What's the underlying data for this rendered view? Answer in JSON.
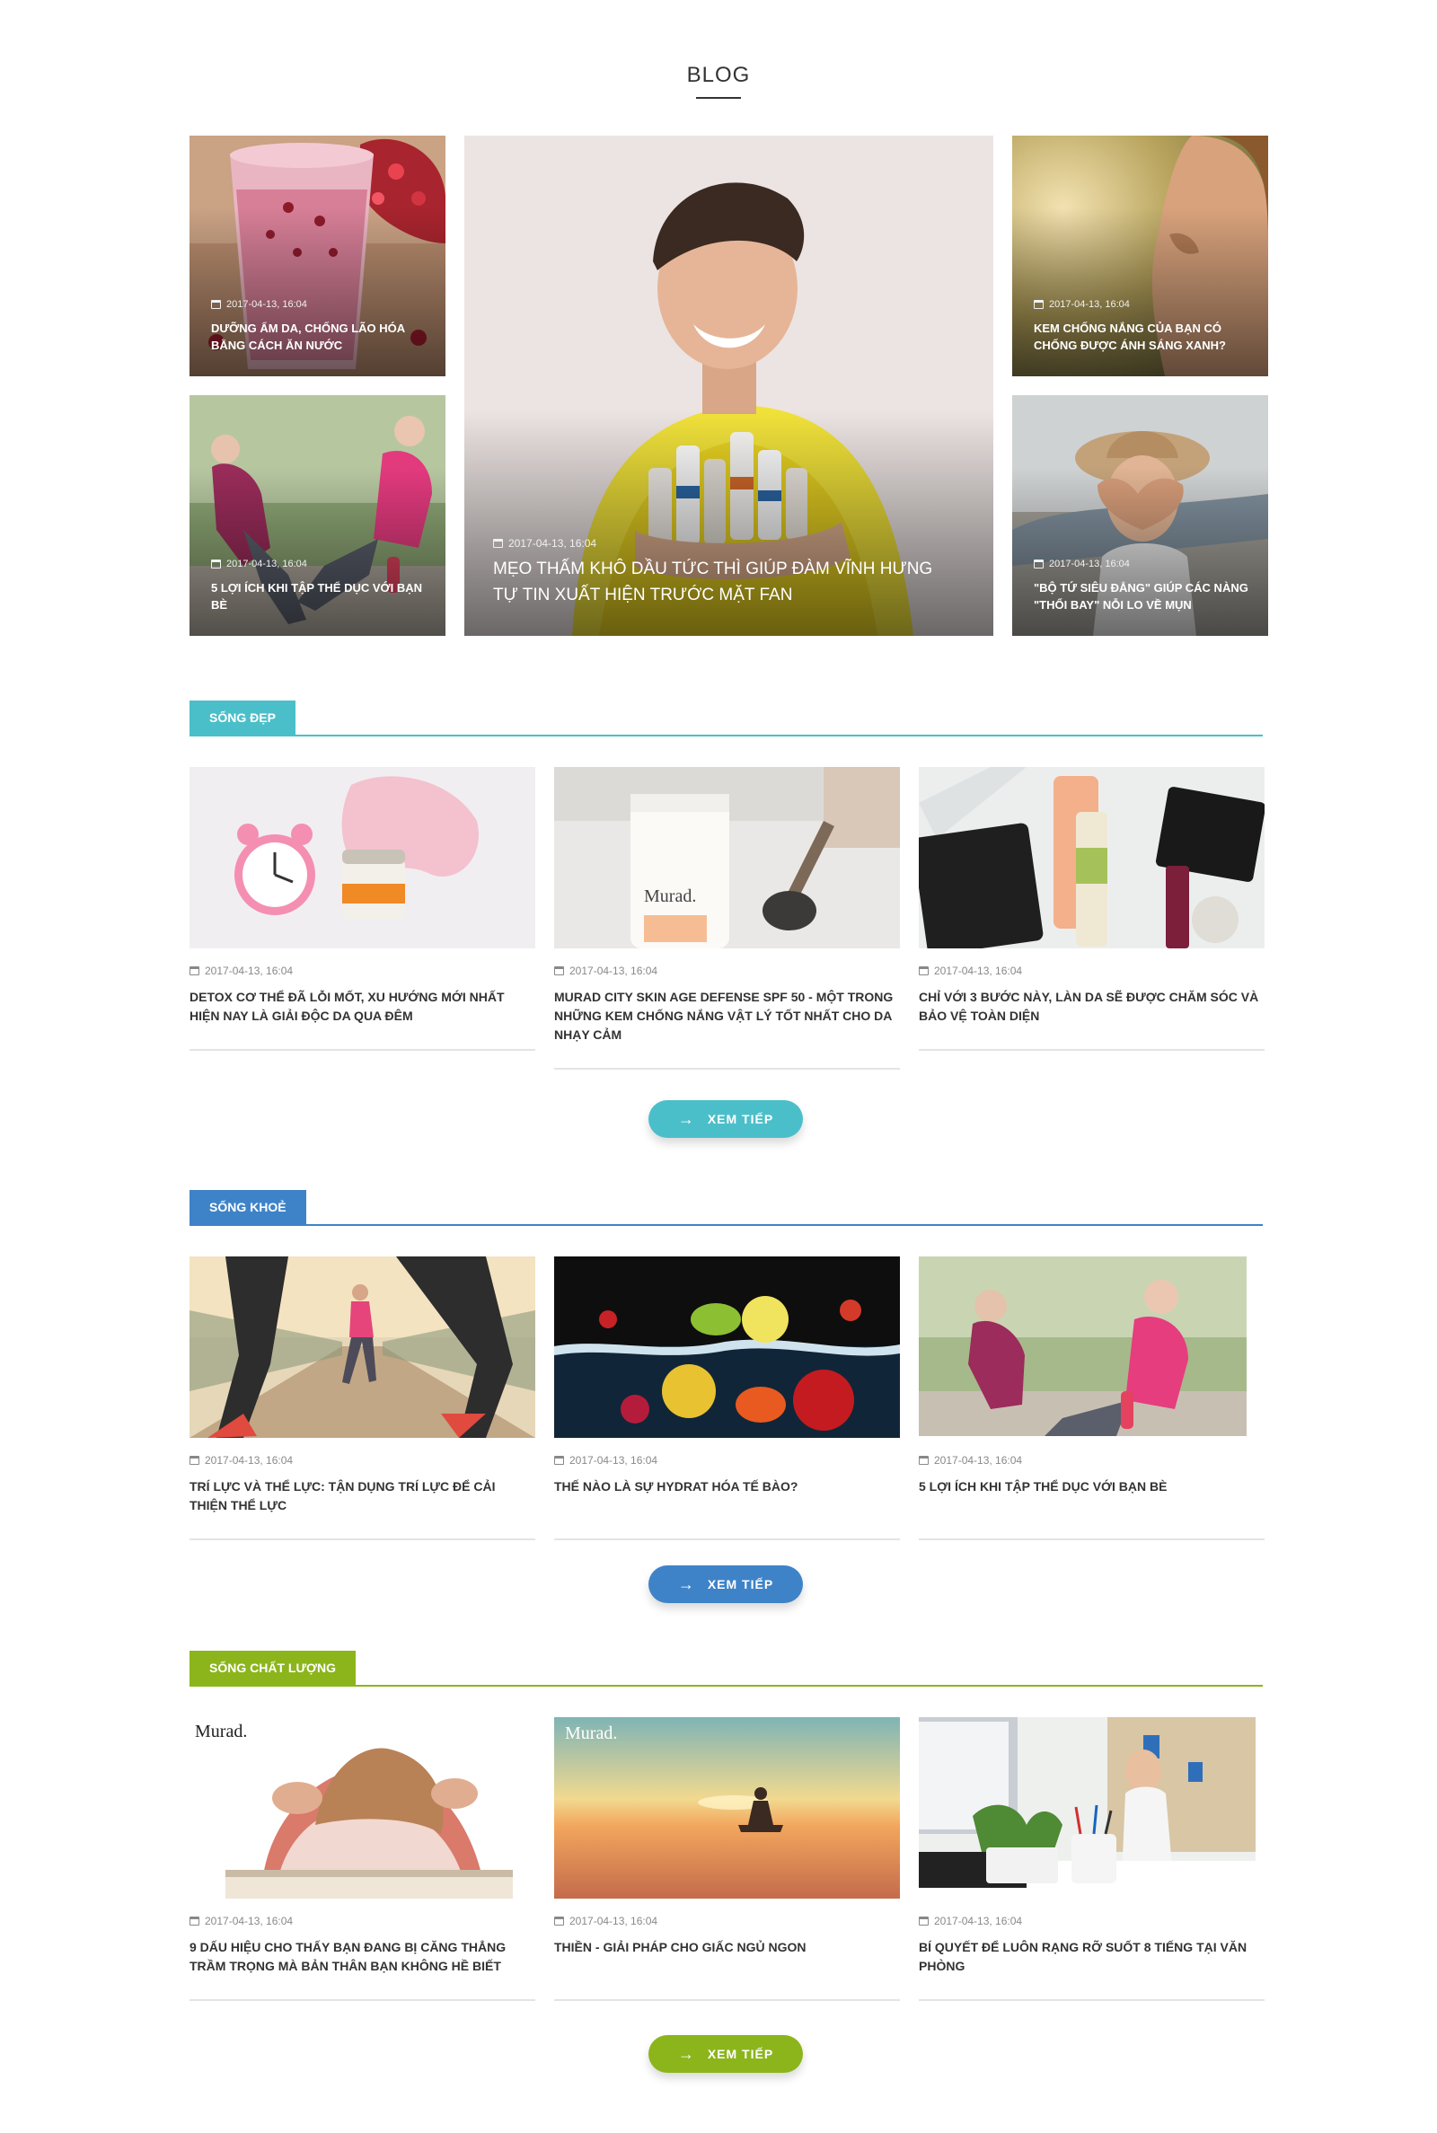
{
  "page": {
    "title": "BLOG"
  },
  "featured": {
    "top_left": {
      "date": "2017-04-13, 16:04",
      "title": "DƯỠNG ẨM DA, CHỐNG LÃO HÓA BẰNG CÁCH ĂN NƯỚC"
    },
    "bottom_left": {
      "date": "2017-04-13, 16:04",
      "title": "5 LỢI ÍCH KHI TẬP THỂ DỤC VỚI BẠN BÈ"
    },
    "center": {
      "date": "2017-04-13, 16:04",
      "title": "MẸO THẤM KHÔ DẦU TỨC THÌ GIÚP ĐÀM VĨNH HƯNG TỰ TIN XUẤT HIỆN TRƯỚC MẶT FAN"
    },
    "top_right": {
      "date": "2017-04-13, 16:04",
      "title": "KEM CHỐNG NẮNG CỦA BẠN CÓ CHỐNG ĐƯỢC ÁNH SÁNG XANH?"
    },
    "bottom_right": {
      "date": "2017-04-13, 16:04",
      "title": "\"BỘ TỨ SIÊU ĐẲNG\" GIÚP CÁC NÀNG \"THỔI BAY\" NỖI LO VỀ MỤN"
    }
  },
  "sections": [
    {
      "label": "SỐNG ĐẸP",
      "color": "#4bbfc9",
      "more_label": "XEM TIẾP",
      "posts": [
        {
          "date": "2017-04-13, 16:04",
          "title": "DETOX CƠ THỂ ĐÃ LỖI MỐT, XU HƯỚNG MỚI NHẤT HIỆN NAY LÀ GIẢI ĐỘC DA QUA ĐÊM"
        },
        {
          "date": "2017-04-13, 16:04",
          "title": "MURAD CITY SKIN AGE DEFENSE SPF 50 - MỘT TRONG NHỮNG KEM CHỐNG NẮNG VẬT LÝ TỐT NHẤT CHO DA NHẠY CẢM"
        },
        {
          "date": "2017-04-13, 16:04",
          "title": "CHỈ VỚI 3 BƯỚC NÀY, LÀN DA SẼ ĐƯỢC CHĂM SÓC VÀ BẢO VỆ TOÀN DIỆN"
        }
      ]
    },
    {
      "label": "SỐNG KHOẺ",
      "color": "#3e83c8",
      "more_label": "XEM TIẾP",
      "posts": [
        {
          "date": "2017-04-13, 16:04",
          "title": "TRÍ LỰC VÀ THỂ LỰC: TẬN DỤNG TRÍ LỰC ĐỂ CẢI THIỆN THỂ LỰC"
        },
        {
          "date": "2017-04-13, 16:04",
          "title": "THẾ NÀO LÀ SỰ HYDRAT HÓA TẾ BÀO?"
        },
        {
          "date": "2017-04-13, 16:04",
          "title": "5 LỢI ÍCH KHI TẬP THỂ DỤC VỚI BẠN BÈ"
        }
      ]
    },
    {
      "label": "SỐNG CHẤT LƯỢNG",
      "color": "#8cb51c",
      "more_label": "XEM TIẾP",
      "posts": [
        {
          "date": "2017-04-13, 16:04",
          "title": "9 DẤU HIỆU CHO THẤY BẠN ĐANG BỊ CĂNG THẲNG TRẦM TRỌNG MÀ BẢN THÂN BẠN KHÔNG HỀ BIẾT"
        },
        {
          "date": "2017-04-13, 16:04",
          "title": "THIỀN - GIẢI PHÁP CHO GIẤC NGỦ NGON"
        },
        {
          "date": "2017-04-13, 16:04",
          "title": "BÍ QUYẾT ĐỂ LUÔN RẠNG RỠ SUỐT 8 TIẾNG TẠI VĂN PHÒNG"
        }
      ]
    }
  ],
  "image_logos": {
    "murad": "Murad."
  }
}
